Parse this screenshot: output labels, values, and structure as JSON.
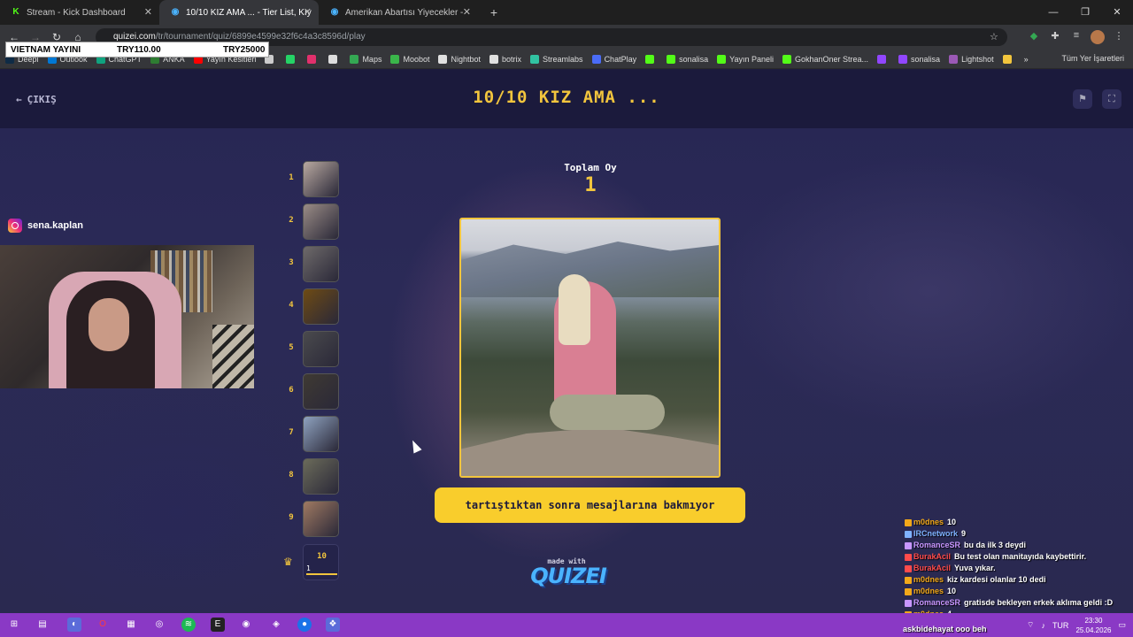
{
  "browser": {
    "tabs": [
      {
        "label": "Stream - Kick Dashboard",
        "favicon": "kick-icon",
        "color": "#53fc18"
      },
      {
        "label": "10/10 KIZ AMA ... - Tier List, Kıy",
        "favicon": "quizei-icon",
        "color": "#4ab3ff"
      },
      {
        "label": "Amerikan Abartısı Yiyecekler -",
        "favicon": "quizei-icon",
        "color": "#4ab3ff"
      }
    ],
    "url_host": "quizei.com",
    "url_path": "/tr/tournament/quiz/6899e4599e32f6c4a3c8596d/play",
    "bookmarks": [
      {
        "label": "Deepl",
        "icon": "deepl-icon",
        "color": "#0f2b46"
      },
      {
        "label": "Outlook",
        "icon": "outlook-icon",
        "color": "#0078d4"
      },
      {
        "label": "ChatGPT",
        "icon": "chatgpt-icon",
        "color": "#10a37f"
      },
      {
        "label": "ANKA",
        "icon": "anka-icon",
        "color": "#2e7d32"
      },
      {
        "label": "Yayın Kesitleri",
        "icon": "youtube-icon",
        "color": "#ff0000"
      },
      {
        "label": "",
        "icon": "folder-icon",
        "color": "#cccccc"
      },
      {
        "label": "",
        "icon": "whatsapp-icon",
        "color": "#25d366"
      },
      {
        "label": "",
        "icon": "instagram-icon",
        "color": "#e1306c"
      },
      {
        "label": "",
        "icon": "x-icon",
        "color": "#dddddd"
      },
      {
        "label": "Maps",
        "icon": "maps-icon",
        "color": "#34a853"
      },
      {
        "label": "Moobot",
        "icon": "moobot-icon",
        "color": "#3ab54a"
      },
      {
        "label": "Nightbot",
        "icon": "nightbot-icon",
        "color": "#e0e0e0"
      },
      {
        "label": "botrix",
        "icon": "botrix-icon",
        "color": "#e0e0e0"
      },
      {
        "label": "Streamlabs",
        "icon": "streamlabs-icon",
        "color": "#31c3a2"
      },
      {
        "label": "ChatPlay",
        "icon": "chatplay-icon",
        "color": "#4a6cf7"
      },
      {
        "label": "",
        "icon": "kick-icon",
        "color": "#53fc18"
      },
      {
        "label": "sonalisa",
        "icon": "kick-icon",
        "color": "#53fc18"
      },
      {
        "label": "Yayın Paneli",
        "icon": "kick-icon",
        "color": "#53fc18"
      },
      {
        "label": "GokhanOner Strea...",
        "icon": "kick-icon",
        "color": "#53fc18"
      },
      {
        "label": "",
        "icon": "twitch-icon",
        "color": "#9146ff"
      },
      {
        "label": "sonalisa",
        "icon": "twitch-icon",
        "color": "#9146ff"
      },
      {
        "label": "Lightshot",
        "icon": "lightshot-icon",
        "color": "#9b59b6"
      },
      {
        "label": "",
        "icon": "emoji-icon",
        "color": "#f2c53d"
      }
    ],
    "bookmarks_more": "»",
    "all_bookmarks": "Tüm Yer İşaretleri"
  },
  "donation_bar": {
    "label": "VIETNAM YAYINI",
    "current": "TRY110.00",
    "goal": "TRY25000"
  },
  "header": {
    "exit_label": "ÇIKIŞ",
    "title": "10/10 KIZ AMA ..."
  },
  "streamer": {
    "instagram": "sena.kaplan"
  },
  "bracket": {
    "rounds": [
      {
        "num": "1",
        "color": "#b9a9a0"
      },
      {
        "num": "2",
        "color": "#9a8c86"
      },
      {
        "num": "3",
        "color": "#6e6a6a"
      },
      {
        "num": "4",
        "color": "#6e4b14"
      },
      {
        "num": "5",
        "color": "#4a4a4d"
      },
      {
        "num": "6",
        "color": "#3f3a33"
      },
      {
        "num": "7",
        "color": "#8fa3c0"
      },
      {
        "num": "8",
        "color": "#6b6b5a"
      },
      {
        "num": "9",
        "color": "#a07a62"
      }
    ],
    "final_num": "10",
    "final_small": "1"
  },
  "vote": {
    "label": "Toplam Oy",
    "count": "1"
  },
  "caption": "tartıştıktan sonra mesajlarına bakmıyor",
  "branding": {
    "made_with": "made with",
    "logo": "QUIZEI"
  },
  "chat": [
    {
      "user": "m0dnes",
      "text": "10",
      "color": "#f2a81a"
    },
    {
      "user": "IRCnetwork",
      "text": "9",
      "color": "#7fb2ff"
    },
    {
      "user": "RomanceSR",
      "text": "bu da ilk 3 deydi",
      "color": "#c896ff"
    },
    {
      "user": "BurakAcil",
      "text": "Bu test olan manitayıda kaybettirir.",
      "color": "#ff4b4b"
    },
    {
      "user": "BurakAcil",
      "text": "Yuva yıkar.",
      "color": "#ff4b4b"
    },
    {
      "user": "m0dnes",
      "text": "kiz kardesi olanlar 10 dedi",
      "color": "#f2a81a"
    },
    {
      "user": "m0dnes",
      "text": "10",
      "color": "#f2a81a"
    },
    {
      "user": "RomanceSR",
      "text": "gratisde bekleyen erkek aklıma geldi :D",
      "color": "#c896ff"
    },
    {
      "user": "m0dnes",
      "text": "4",
      "color": "#f2a81a"
    }
  ],
  "taskbar": {
    "stream_overlay": "askbidehayat",
    "stream_overlay_text": "ooo beh",
    "lang": "TUR",
    "time": "23:30",
    "date": "25.04.2026"
  }
}
